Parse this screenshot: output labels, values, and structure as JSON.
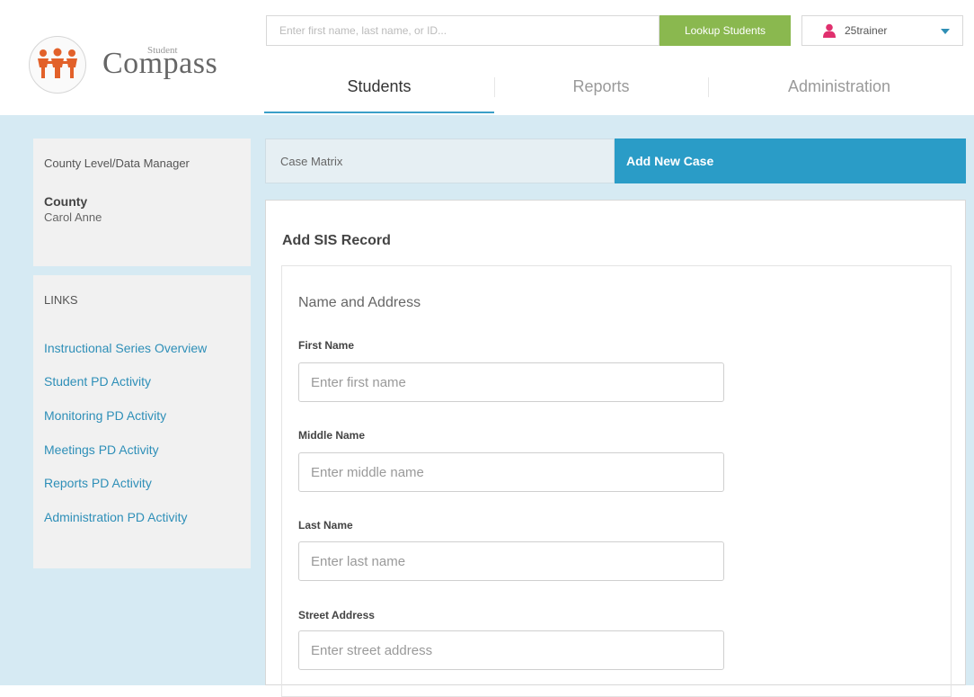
{
  "header": {
    "logo": {
      "small": "Student",
      "big": "Compass"
    },
    "search": {
      "placeholder": "Enter first name, last name, or ID...",
      "value": ""
    },
    "lookup_button": "Lookup Students",
    "user": {
      "name": "25trainer"
    }
  },
  "nav": {
    "tabs": [
      {
        "label": "Students",
        "active": true
      },
      {
        "label": "Reports",
        "active": false
      },
      {
        "label": "Administration",
        "active": false
      }
    ]
  },
  "sidebar": {
    "role": "County Level/Data Manager",
    "org": "County",
    "person": "Carol Anne",
    "links_heading": "LINKS",
    "links": [
      "Instructional Series Overview",
      "Student PD Activity",
      "Monitoring PD Activity",
      "Meetings PD Activity",
      "Reports PD Activity",
      "Administration PD Activity"
    ]
  },
  "tabs": {
    "case_matrix": "Case Matrix",
    "add_new_case": "Add New Case"
  },
  "form": {
    "title": "Add SIS Record",
    "section": "Name and Address",
    "fields": [
      {
        "label": "First Name",
        "placeholder": "Enter first name",
        "value": ""
      },
      {
        "label": "Middle Name",
        "placeholder": "Enter middle name",
        "value": ""
      },
      {
        "label": "Last Name",
        "placeholder": "Enter last name",
        "value": ""
      },
      {
        "label": "Street Address",
        "placeholder": "Enter street address",
        "value": ""
      }
    ]
  },
  "colors": {
    "accent": "#2a9cc7",
    "lookup_green": "#8ab84f",
    "link_blue": "#2e8fb8",
    "content_bg": "#d6eaf3",
    "user_icon": "#e0306e"
  }
}
